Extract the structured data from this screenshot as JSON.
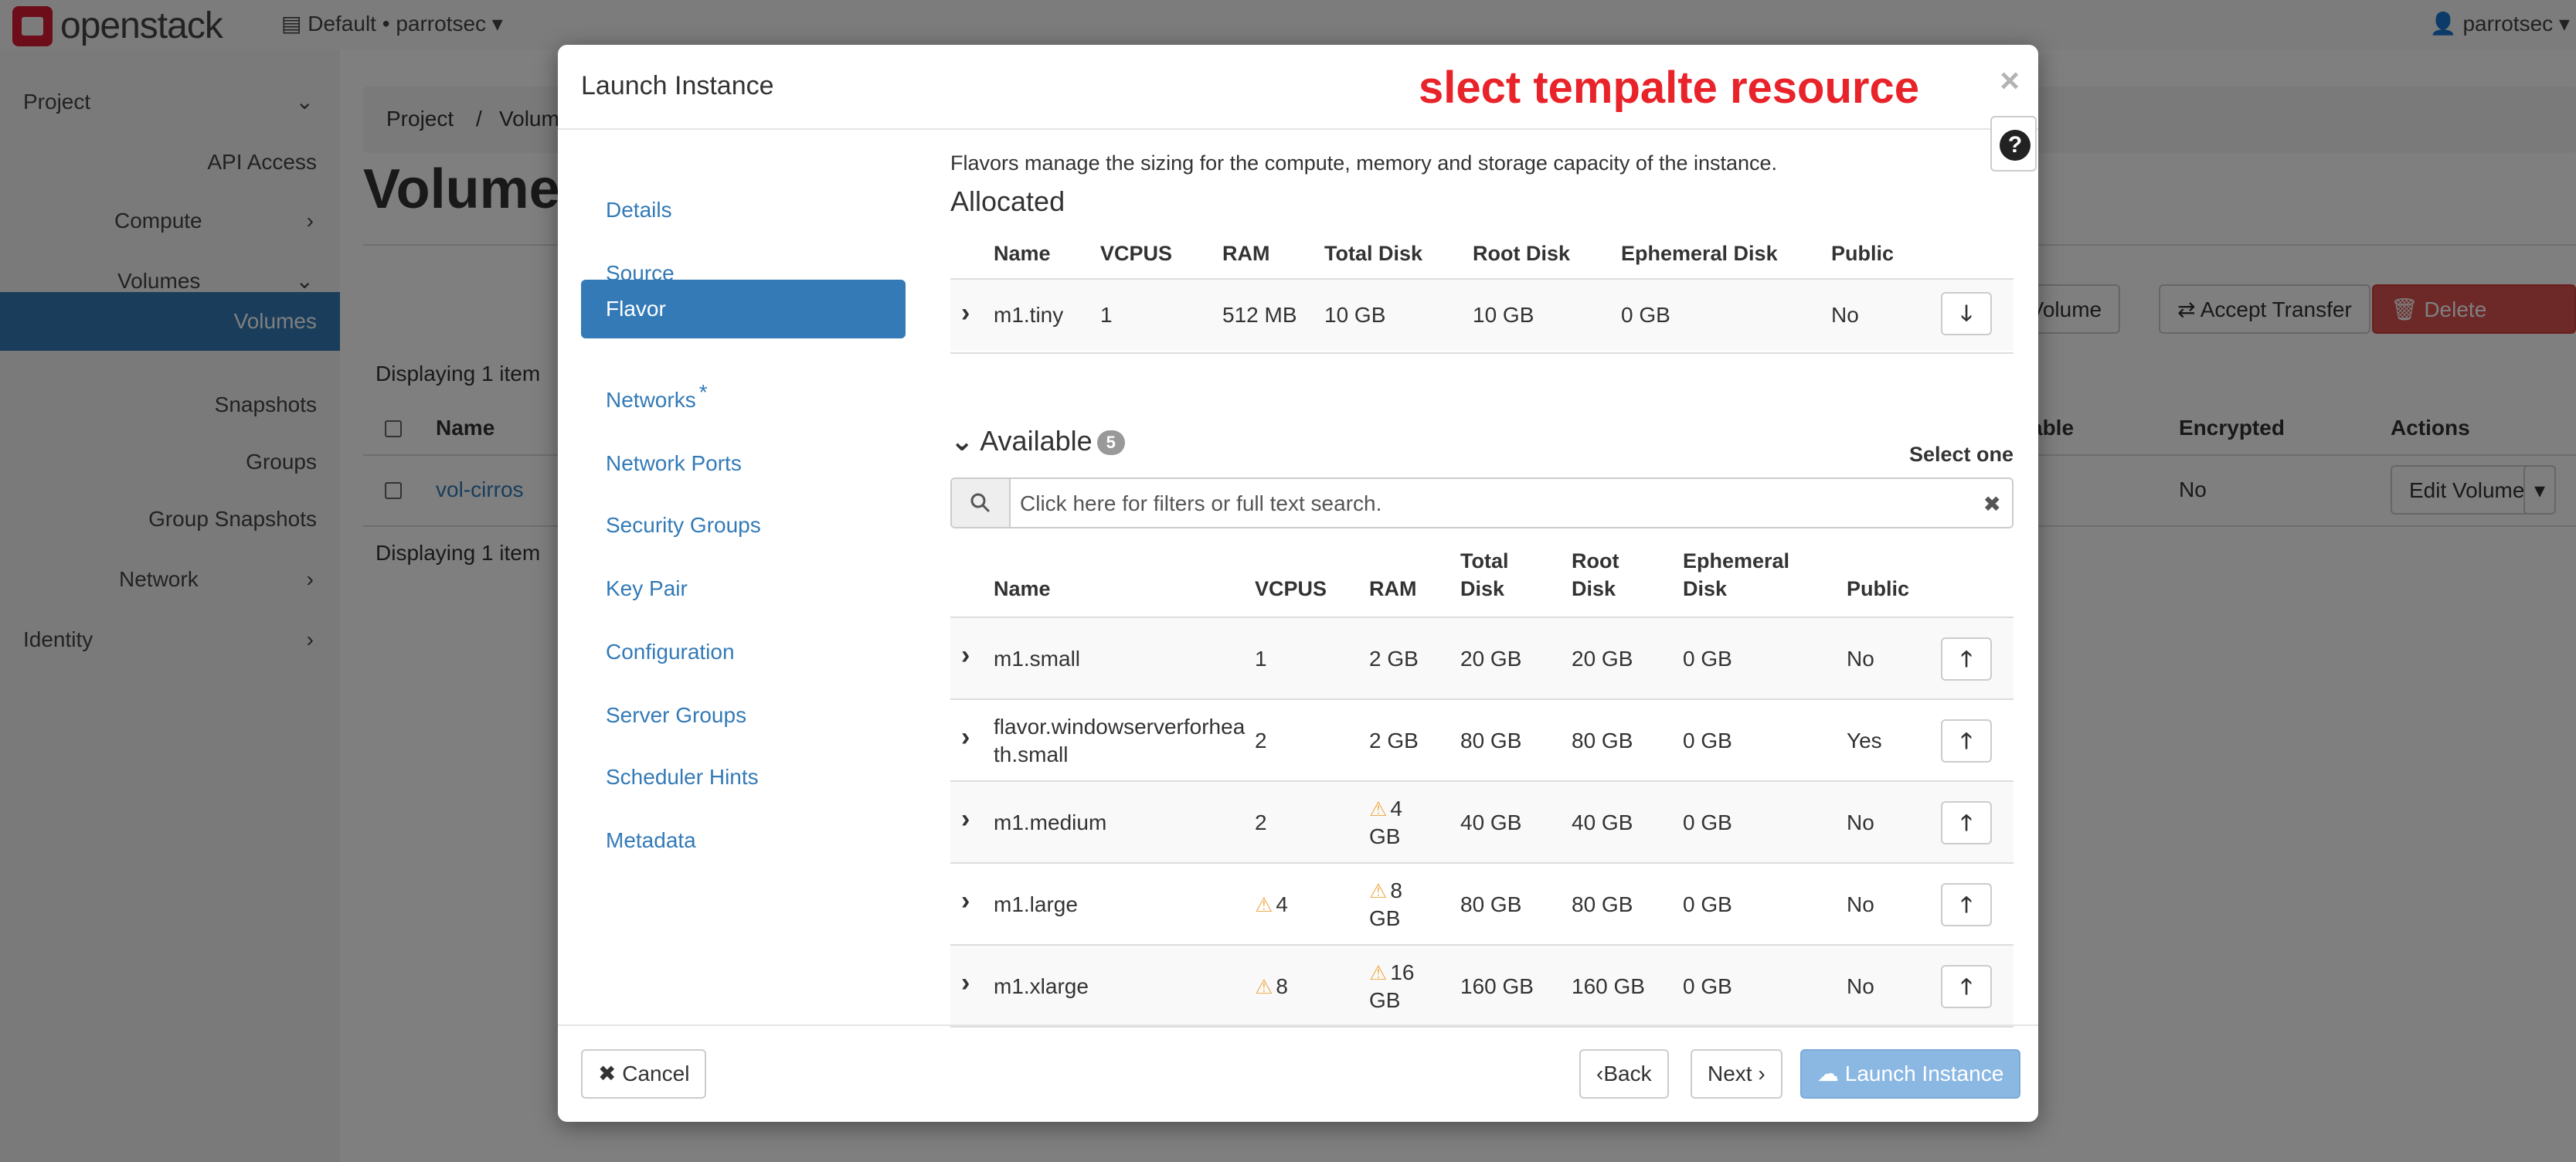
{
  "brand": {
    "name": "openstack"
  },
  "topbar": {
    "project_selector": "Default • parrotsec",
    "user": "parrotsec"
  },
  "sidebar": {
    "project": "Project",
    "api_access": "API Access",
    "compute": "Compute",
    "volumes_group": "Volumes",
    "volumes": "Volumes",
    "snapshots": "Snapshots",
    "groups": "Groups",
    "group_snapshots": "Group Snapshots",
    "network": "Network",
    "identity": "Identity"
  },
  "background": {
    "breadcrumb": [
      "Project",
      "/",
      "Volumes"
    ],
    "page_title": "Volumes",
    "displaying_top": "Displaying 1 item",
    "displaying_bottom": "Displaying 1 item",
    "buttons": {
      "create_volume": "ate Volume",
      "accept_transfer": "Accept Transfer",
      "delete_volumes": "Delete Volumes"
    },
    "table_headers": {
      "name": "Name",
      "bootable": "able",
      "encrypted": "Encrypted",
      "actions": "Actions"
    },
    "row": {
      "name": "vol-cirros",
      "encrypted": "No",
      "action": "Edit Volume"
    }
  },
  "modal": {
    "title": "Launch Instance",
    "annotation": "slect tempalte resource",
    "close": "×",
    "help": "?",
    "nav": [
      "Details",
      "Source",
      "Flavor",
      "Networks",
      "Network Ports",
      "Security Groups",
      "Key Pair",
      "Configuration",
      "Server Groups",
      "Scheduler Hints",
      "Metadata"
    ],
    "required_mark": "*",
    "intro": "Flavors manage the sizing for the compute, memory and storage capacity of the instance.",
    "allocated": {
      "title": "Allocated",
      "headers": {
        "name": "Name",
        "vcpus": "VCPUS",
        "ram": "RAM",
        "total_disk": "Total Disk",
        "root_disk": "Root Disk",
        "ephemeral_disk": "Ephemeral Disk",
        "public": "Public"
      },
      "row": {
        "name": "m1.tiny",
        "vcpus": "1",
        "ram": "512 MB",
        "total_disk": "10 GB",
        "root_disk": "10 GB",
        "ephemeral_disk": "0 GB",
        "public": "No"
      }
    },
    "available": {
      "title": "Available",
      "count": "5",
      "select_one": "Select one",
      "search_placeholder": "Click here for filters or full text search.",
      "headers": {
        "name": "Name",
        "vcpus": "VCPUS",
        "ram": "RAM",
        "total_disk": [
          "Total",
          "Disk"
        ],
        "root_disk": [
          "Root",
          "Disk"
        ],
        "ephemeral_disk": [
          "Ephemeral",
          "Disk"
        ],
        "public": "Public"
      },
      "rows": [
        {
          "name": [
            "m1.small"
          ],
          "vcpus": "1",
          "vcpus_warn": false,
          "ram": [
            "2 GB"
          ],
          "ram_warn": false,
          "total_disk": "20 GB",
          "root_disk": "20 GB",
          "ephemeral_disk": "0 GB",
          "public": "No"
        },
        {
          "name": [
            "flavor.windowserverforhea",
            "th.small"
          ],
          "vcpus": "2",
          "vcpus_warn": false,
          "ram": [
            "2 GB"
          ],
          "ram_warn": false,
          "total_disk": "80 GB",
          "root_disk": "80 GB",
          "ephemeral_disk": "0 GB",
          "public": "Yes"
        },
        {
          "name": [
            "m1.medium"
          ],
          "vcpus": "2",
          "vcpus_warn": false,
          "ram": [
            "4",
            "GB"
          ],
          "ram_warn": true,
          "total_disk": "40 GB",
          "root_disk": "40 GB",
          "ephemeral_disk": "0 GB",
          "public": "No"
        },
        {
          "name": [
            "m1.large"
          ],
          "vcpus": "4",
          "vcpus_warn": true,
          "ram": [
            "8",
            "GB"
          ],
          "ram_warn": true,
          "total_disk": "80 GB",
          "root_disk": "80 GB",
          "ephemeral_disk": "0 GB",
          "public": "No"
        },
        {
          "name": [
            "m1.xlarge"
          ],
          "vcpus": "8",
          "vcpus_warn": true,
          "ram": [
            "16",
            "GB"
          ],
          "ram_warn": true,
          "total_disk": "160 GB",
          "root_disk": "160 GB",
          "ephemeral_disk": "0 GB",
          "public": "No"
        }
      ]
    },
    "footer": {
      "cancel": "Cancel",
      "back": "Back",
      "next": "Next",
      "launch": "Launch Instance"
    }
  },
  "colors": {
    "primary": "#337ab7",
    "danger": "#d9534f",
    "warning": "#f0ad4e",
    "annotation": "#e8232a",
    "launch_disabled": "#8bb8e3"
  }
}
